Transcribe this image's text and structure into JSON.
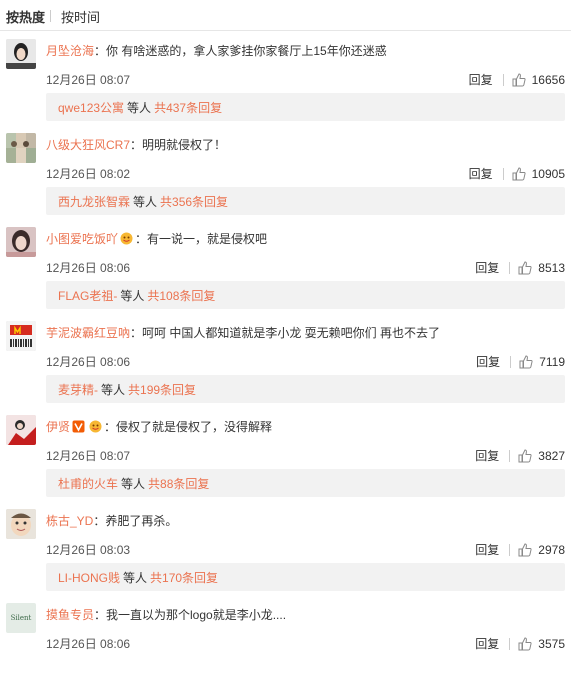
{
  "sort": {
    "hot": "按热度",
    "time": "按时间"
  },
  "comments": [
    {
      "user": "月坠沧海",
      "text": "：你 有啥迷惑的，拿人家爹挂你家餐厅上15年你还迷惑",
      "time": "12月26日 08:07",
      "reply": "回复",
      "likes": "16656",
      "reply_user": "qwe123公寓",
      "reply_mid": "等人",
      "reply_total": "共437条回复",
      "badges": []
    },
    {
      "user": "八级大狂风CR7",
      "text": "：明明就侵权了！",
      "time": "12月26日 08:02",
      "reply": "回复",
      "likes": "10905",
      "reply_user": "西九龙张智霖",
      "reply_mid": "等人",
      "reply_total": "共356条回复",
      "badges": []
    },
    {
      "user": "小图爱吃饭吖",
      "text": "：有一说一，就是侵权吧",
      "time": "12月26日 08:06",
      "reply": "回复",
      "likes": "8513",
      "reply_user": "FLAG老祖-",
      "reply_mid": "等人",
      "reply_total": "共108条回复",
      "badges": [
        "emoji-badge-icon"
      ]
    },
    {
      "user": "芋泥波霸红豆吶",
      "text": "：呵呵 中国人都知道就是李小龙 耍无赖吧你们 再也不去了",
      "time": "12月26日 08:06",
      "reply": "回复",
      "likes": "7119",
      "reply_user": "麦芽精-",
      "reply_mid": "等人",
      "reply_total": "共199条回复",
      "badges": []
    },
    {
      "user": "伊贤",
      "text": "：侵权了就是侵权了，没得解释",
      "time": "12月26日 08:07",
      "reply": "回复",
      "likes": "3827",
      "reply_user": "杜甫的火车",
      "reply_mid": "等人",
      "reply_total": "共88条回复",
      "badges": [
        "vip-v-icon",
        "emoji-badge-icon"
      ]
    },
    {
      "user": "栋古_YD",
      "text": "：养肥了再杀。",
      "time": "12月26日 08:03",
      "reply": "回复",
      "likes": "2978",
      "reply_user": "LI-HONG贱",
      "reply_mid": "等人",
      "reply_total": "共170条回复",
      "badges": []
    },
    {
      "user": "摸鱼专员",
      "text": "：我一直以为那个logo就是李小龙....",
      "time": "12月26日 08:06",
      "reply": "回复",
      "likes": "3575",
      "reply_user": "",
      "reply_mid": "",
      "reply_total": "",
      "badges": []
    }
  ],
  "avatar_7_text": "Silent",
  "colors": {
    "username": "#eb7350",
    "reply_bg": "#f2f2f2",
    "divider": "#e6e6e6"
  }
}
